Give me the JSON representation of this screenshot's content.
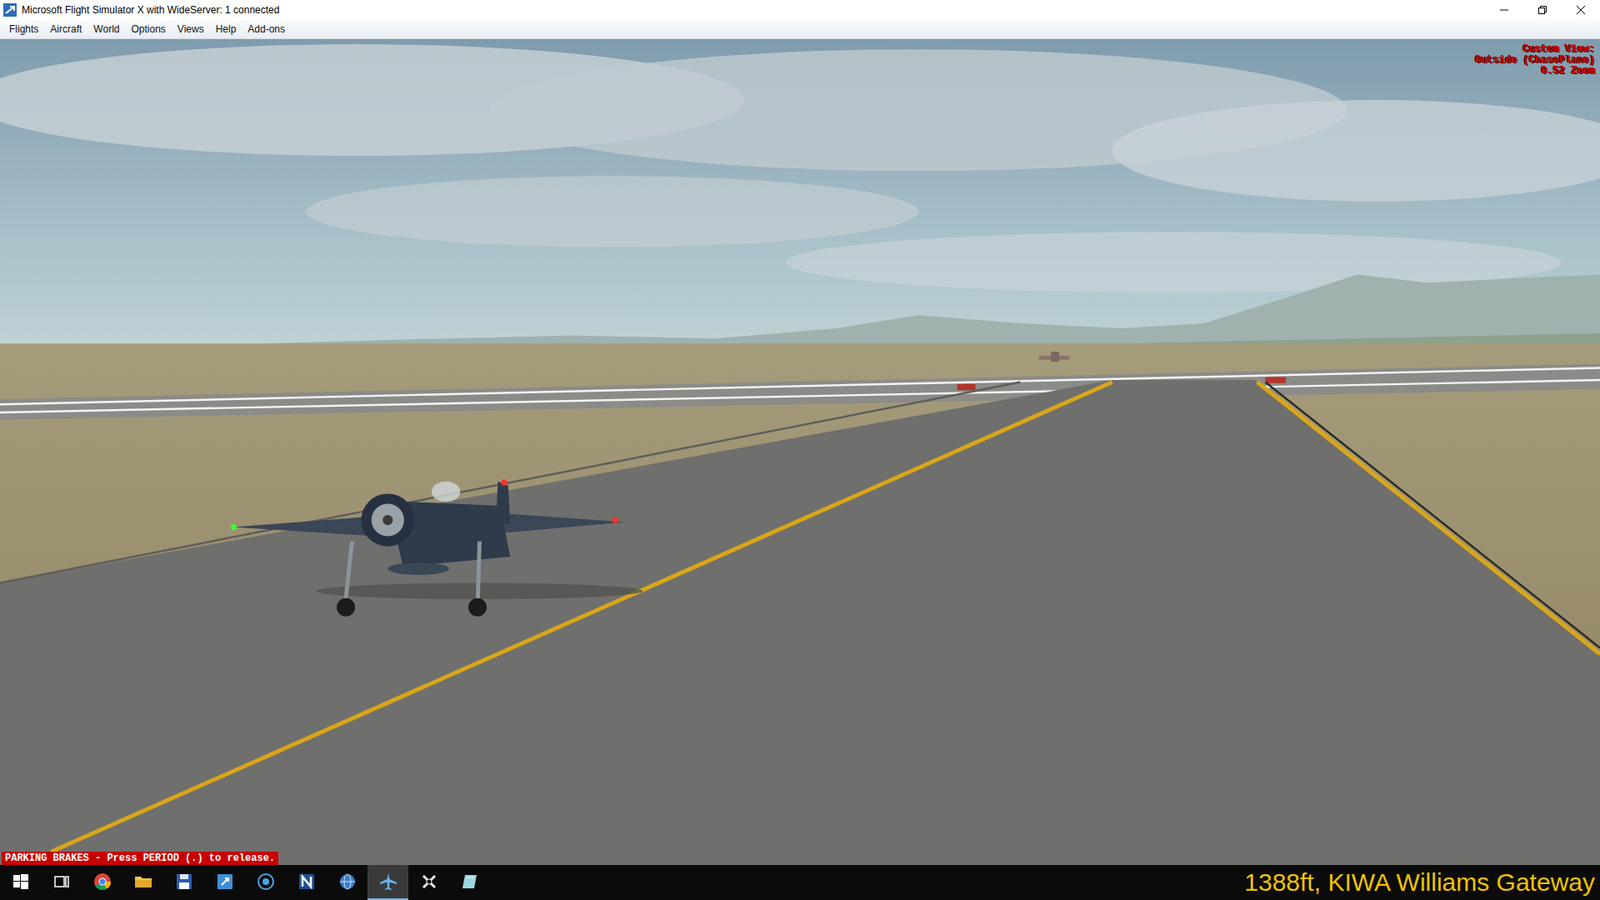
{
  "window": {
    "title": "Microsoft Flight Simulator X with WideServer: 1 connected"
  },
  "menu": [
    {
      "label": "Flights"
    },
    {
      "label": "Aircraft"
    },
    {
      "label": "World"
    },
    {
      "label": "Options"
    },
    {
      "label": "Views"
    },
    {
      "label": "Help"
    },
    {
      "label": "Add-ons"
    }
  ],
  "view_info": {
    "lines": [
      "Custom View:",
      "Outside (ChasePlane)",
      "0.52 Zoom"
    ]
  },
  "status_message": "PARKING BRAKES - Press PERIOD (.) to release.",
  "location_readout": "1388ft, KIWA Williams Gateway",
  "taskbar": {
    "items": [
      {
        "kind": "start",
        "active": false
      },
      {
        "kind": "taskview",
        "active": false
      },
      {
        "kind": "chrome",
        "active": false
      },
      {
        "kind": "explorer",
        "active": false
      },
      {
        "kind": "save",
        "active": false
      },
      {
        "kind": "app",
        "active": false
      },
      {
        "kind": "remote",
        "active": false
      },
      {
        "kind": "notes",
        "active": false
      },
      {
        "kind": "globe",
        "active": false
      },
      {
        "kind": "fsx",
        "active": true
      },
      {
        "kind": "xplane",
        "active": false
      },
      {
        "kind": "tablet",
        "active": false
      }
    ]
  }
}
